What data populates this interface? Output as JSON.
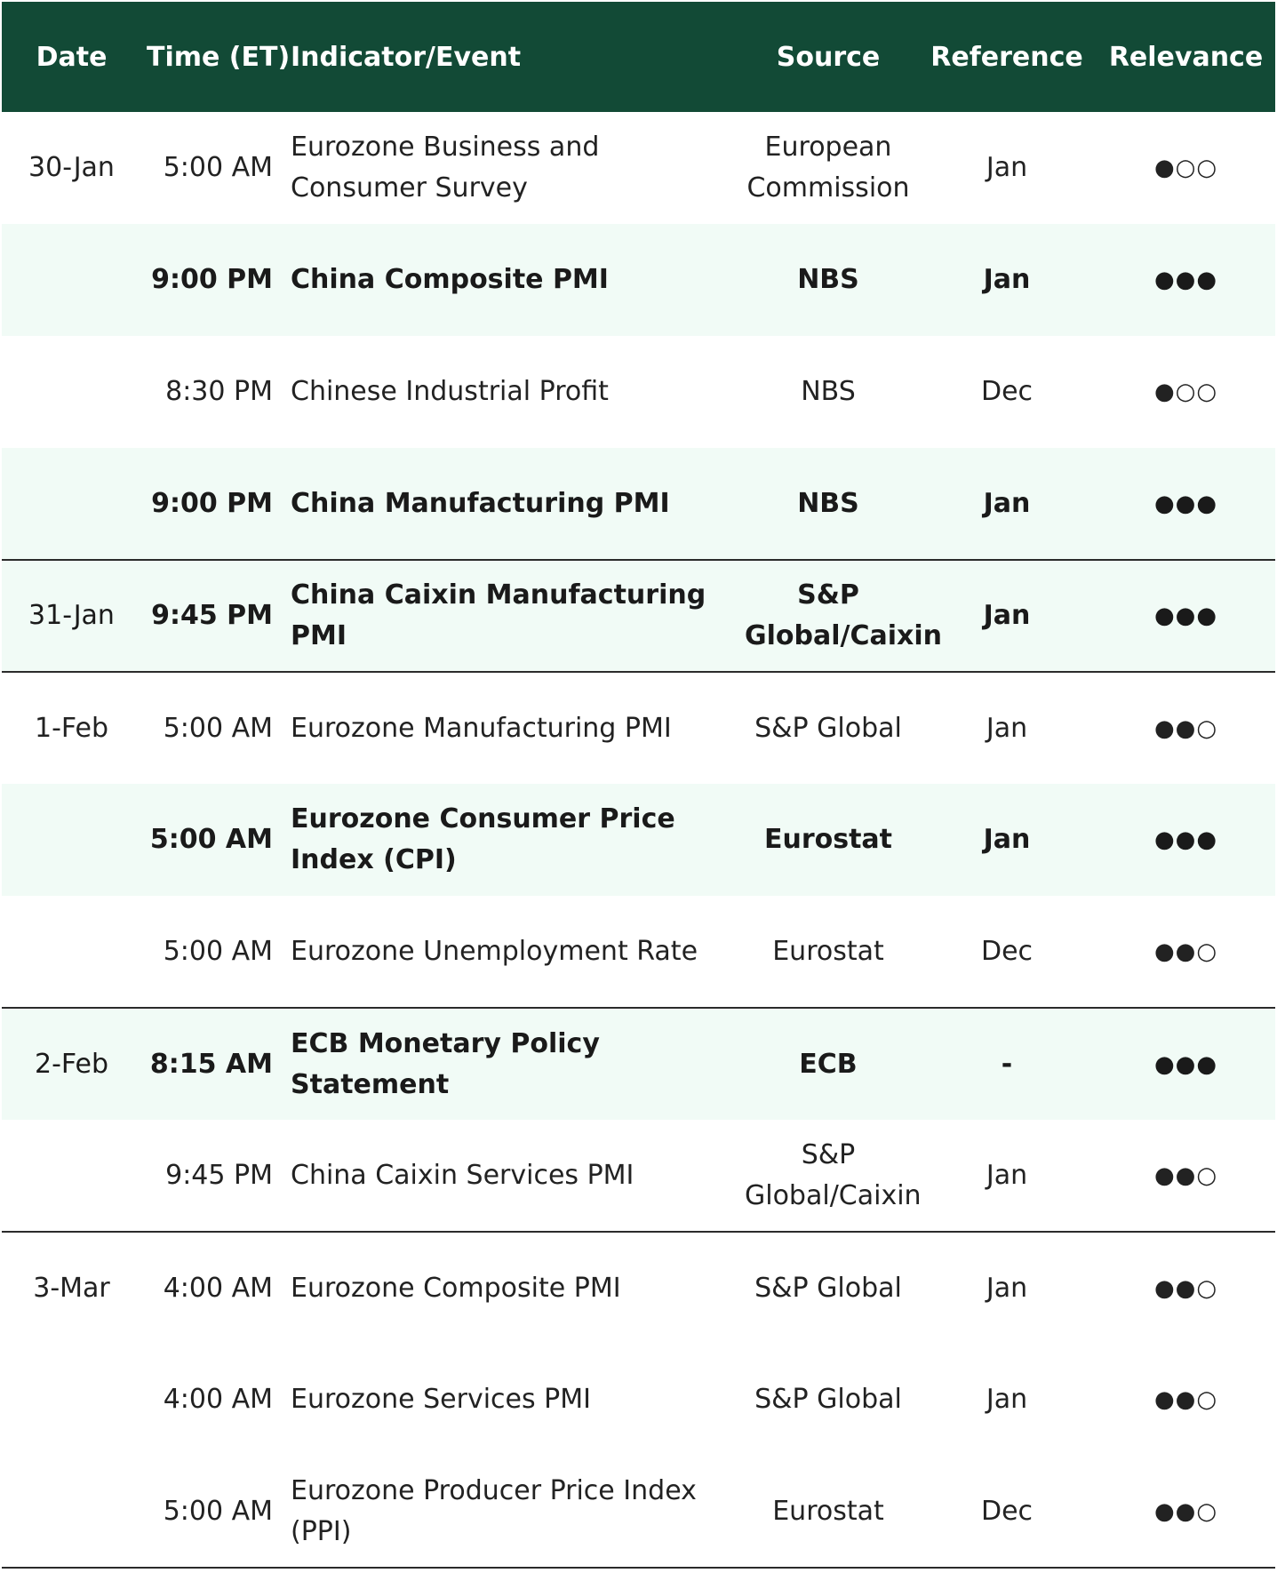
{
  "headers": {
    "date": "Date",
    "time": "Time (ET)",
    "indicator": "Indicator/Event",
    "source": "Source",
    "reference": "Reference",
    "relevance": "Relevance"
  },
  "rows": [
    {
      "date": "30-Jan",
      "time": "5:00 AM",
      "indicator": "Eurozone Business and Consumer Survey",
      "source": "European Commission",
      "reference": "Jan",
      "relevance": "●○○"
    },
    {
      "date": "",
      "time": "9:00 PM",
      "indicator": "China Composite PMI",
      "source": "NBS",
      "reference": "Jan",
      "relevance": "●●●"
    },
    {
      "date": "",
      "time": "8:30 PM",
      "indicator": "Chinese Industrial Profit",
      "source": "NBS",
      "reference": "Dec",
      "relevance": "●○○"
    },
    {
      "date": "",
      "time": "9:00 PM",
      "indicator": "China Manufacturing PMI",
      "source": "NBS",
      "reference": "Jan",
      "relevance": "●●●"
    },
    {
      "date": "31-Jan",
      "time": "9:45 PM",
      "indicator": "China Caixin Manufacturing PMI",
      "source": "S&P Global/Caixin",
      "reference": "Jan",
      "relevance": "●●●"
    },
    {
      "date": "1-Feb",
      "time": "5:00 AM",
      "indicator": "Eurozone Manufacturing PMI",
      "source": "S&P Global",
      "reference": "Jan",
      "relevance": "●●○"
    },
    {
      "date": "",
      "time": "5:00 AM",
      "indicator": "Eurozone Consumer Price Index (CPI)",
      "source": "Eurostat",
      "reference": "Jan",
      "relevance": "●●●"
    },
    {
      "date": "",
      "time": "5:00 AM",
      "indicator": "Eurozone Unemployment Rate",
      "source": "Eurostat",
      "reference": "Dec",
      "relevance": "●●○"
    },
    {
      "date": "2-Feb",
      "time": "8:15 AM",
      "indicator": "ECB Monetary Policy Statement",
      "source": "ECB",
      "reference": "-",
      "relevance": "●●●"
    },
    {
      "date": "",
      "time": "9:45 PM",
      "indicator": "China Caixin Services PMI",
      "source": "S&P Global/Caixin",
      "reference": "Jan",
      "relevance": "●●○"
    },
    {
      "date": "3-Mar",
      "time": "4:00 AM",
      "indicator": "Eurozone Composite PMI",
      "source": "S&P Global",
      "reference": "Jan",
      "relevance": "●●○"
    },
    {
      "date": "",
      "time": "4:00 AM",
      "indicator": "Eurozone Services PMI",
      "source": "S&P Global",
      "reference": "Jan",
      "relevance": "●●○"
    },
    {
      "date": "",
      "time": "5:00 AM",
      "indicator": "Eurozone Producer Price Index (PPI)",
      "source": "Eurostat",
      "reference": "Dec",
      "relevance": "●●○"
    }
  ]
}
